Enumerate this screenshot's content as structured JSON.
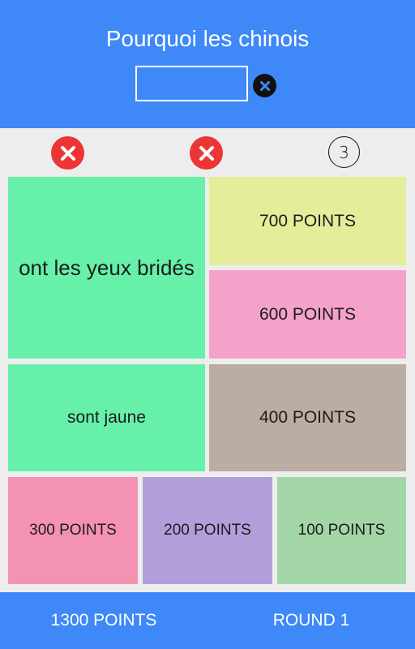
{
  "question": "Pourquoi les chinois",
  "answer_input": {
    "value": "",
    "placeholder": ""
  },
  "strikes": [
    {
      "icon": "x-icon",
      "color": "#ee3535"
    },
    {
      "icon": "x-icon",
      "color": "#ee3535"
    }
  ],
  "timer": {
    "value": "3"
  },
  "tiles": [
    {
      "text": "ont les yeux bridés",
      "revealed": true,
      "color": "#66f0aa"
    },
    {
      "text": "700 POINTS",
      "revealed": false,
      "color": "#e6ed9a"
    },
    {
      "text": "600 POINTS",
      "revealed": false,
      "color": "#f4a2c9"
    },
    {
      "text": "sont jaune",
      "revealed": true,
      "color": "#66f0aa"
    },
    {
      "text": "400 POINTS",
      "revealed": false,
      "color": "#bbaca4"
    },
    {
      "text": "300 POINTS",
      "revealed": false,
      "color": "#f492b2"
    },
    {
      "text": "200 POINTS",
      "revealed": false,
      "color": "#b19edb"
    },
    {
      "text": "100 POINTS",
      "revealed": false,
      "color": "#a3d6a6"
    }
  ],
  "footer": {
    "score": "1300 POINTS",
    "round": "ROUND 1"
  },
  "colors": {
    "primary": "#3f88f8",
    "background": "#ededed",
    "strike": "#ee3535"
  }
}
